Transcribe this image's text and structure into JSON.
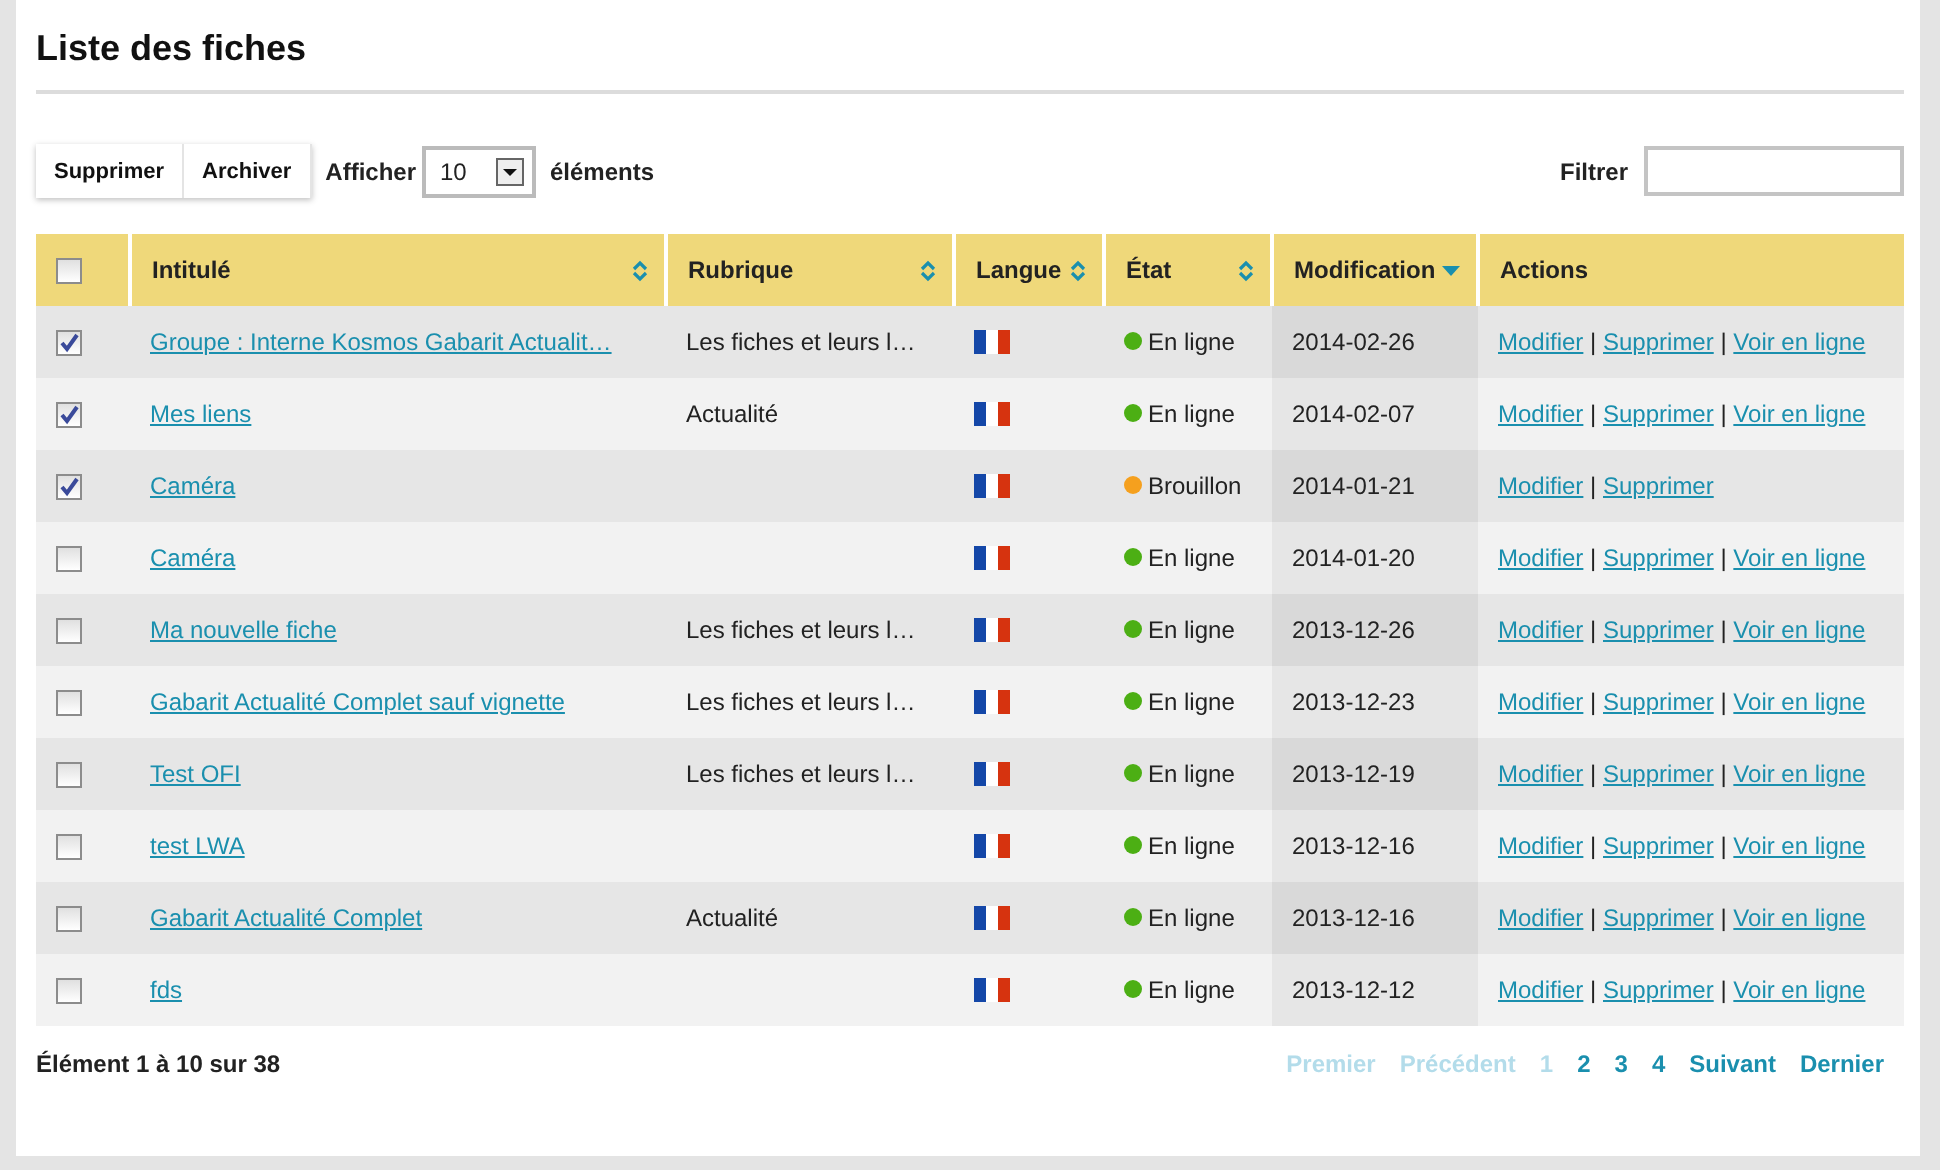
{
  "title": "Liste des fiches",
  "toolbar": {
    "buttons": [
      "Supprimer",
      "Archiver"
    ],
    "show_label": "Afficher",
    "page_size": "10",
    "items_label": "éléments",
    "filter_label": "Filtrer"
  },
  "table": {
    "select_all": {
      "checked": false
    },
    "columns": [
      {
        "label": "Intitulé",
        "sortable": true,
        "sorted_desc": false
      },
      {
        "label": "Rubrique",
        "sortable": true,
        "sorted_desc": false
      },
      {
        "label": "Langue",
        "sortable": true,
        "sorted_desc": false
      },
      {
        "label": "État",
        "sortable": true,
        "sorted_desc": false
      },
      {
        "label": "Modification",
        "sortable": true,
        "sorted_desc": true
      },
      {
        "label": "Actions",
        "sortable": false
      }
    ],
    "rows": [
      {
        "checked": true,
        "title": "Groupe : Interne Kosmos Gabarit Actualit…",
        "rubrique": "Les fiches et leurs l…",
        "status": "En ligne",
        "color": "#4caf14",
        "date": "2014-02-26",
        "actions": [
          "Modifier",
          "|",
          "Supprimer",
          "|",
          "Voir en ligne"
        ]
      },
      {
        "checked": true,
        "title": "Mes liens",
        "rubrique": "Actualité",
        "status": "En ligne",
        "color": "#4caf14",
        "date": "2014-02-07",
        "actions": [
          "Modifier",
          "|",
          "Supprimer",
          "|",
          "Voir en ligne"
        ]
      },
      {
        "checked": true,
        "title": "Caméra",
        "rubrique": "",
        "status": "Brouillon",
        "color": "#f5a01e",
        "date": "2014-01-21",
        "actions": [
          "Modifier",
          "|",
          "Supprimer"
        ]
      },
      {
        "checked": false,
        "title": "Caméra",
        "rubrique": "",
        "status": "En ligne",
        "color": "#4caf14",
        "date": "2014-01-20",
        "actions": [
          "Modifier",
          "|",
          "Supprimer",
          "|",
          "Voir en ligne"
        ]
      },
      {
        "checked": false,
        "title": "Ma nouvelle fiche",
        "rubrique": "Les fiches et leurs l…",
        "status": "En ligne",
        "color": "#4caf14",
        "date": "2013-12-26",
        "actions": [
          "Modifier",
          "|",
          "Supprimer",
          "|",
          "Voir en ligne"
        ]
      },
      {
        "checked": false,
        "title": "Gabarit Actualité Complet sauf vignette",
        "rubrique": "Les fiches et leurs l…",
        "status": "En ligne",
        "color": "#4caf14",
        "date": "2013-12-23",
        "actions": [
          "Modifier",
          "|",
          "Supprimer",
          "|",
          "Voir en ligne"
        ]
      },
      {
        "checked": false,
        "title": "Test OFI",
        "rubrique": "Les fiches et leurs l…",
        "status": "En ligne",
        "color": "#4caf14",
        "date": "2013-12-19",
        "actions": [
          "Modifier",
          "|",
          "Supprimer",
          "|",
          "Voir en ligne"
        ]
      },
      {
        "checked": false,
        "title": "test LWA",
        "rubrique": "",
        "status": "En ligne",
        "color": "#4caf14",
        "date": "2013-12-16",
        "actions": [
          "Modifier",
          "|",
          "Supprimer",
          "|",
          "Voir en ligne"
        ]
      },
      {
        "checked": false,
        "title": "Gabarit Actualité Complet ",
        "rubrique": "Actualité",
        "status": "En ligne",
        "color": "#4caf14",
        "date": "2013-12-16",
        "actions": [
          "Modifier",
          "|",
          "Supprimer",
          "|",
          "Voir en ligne"
        ]
      },
      {
        "checked": false,
        "title": "fds",
        "rubrique": "",
        "status": "En ligne",
        "color": "#4caf14",
        "date": "2013-12-12",
        "actions": [
          "Modifier",
          "|",
          "Supprimer",
          "|",
          "Voir en ligne"
        ]
      }
    ]
  },
  "footer": {
    "info": "Élément 1 à 10 sur 38",
    "nav_before": [
      {
        "label": "Premier",
        "disabled": true
      },
      {
        "label": "Précédent",
        "disabled": true
      }
    ],
    "pages": [
      {
        "label": "1",
        "selected": true
      },
      {
        "label": "2",
        "selected": false
      },
      {
        "label": "3",
        "selected": false
      },
      {
        "label": "4",
        "selected": false
      }
    ],
    "nav_after": [
      {
        "label": "Suivant",
        "disabled": false
      },
      {
        "label": "Dernier",
        "disabled": false
      }
    ]
  }
}
